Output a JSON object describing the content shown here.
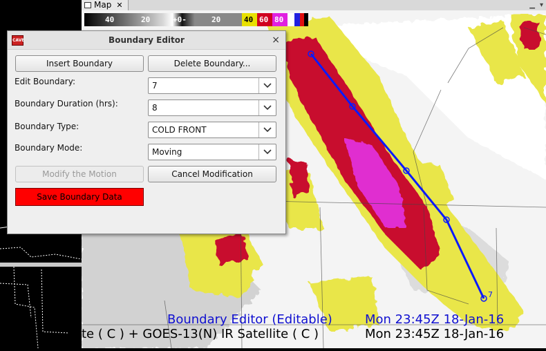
{
  "app": {
    "map_tab_label": "Map",
    "close_glyph": "✕",
    "menu_glyph": "▾"
  },
  "colorbar": {
    "ticks": [
      "40",
      "20",
      "+0-",
      "20",
      "40",
      "60",
      "80"
    ]
  },
  "overlays": {
    "boundary_editor_label": "Boundary Editor (Editable)",
    "boundary_editor_time": "Mon 23:45Z 18-Jan-16",
    "satellite_label": "te ( C )  + GOES-13(N) IR Satellite ( C )",
    "satellite_time": "Mon 23:45Z 18-Jan-16"
  },
  "boundary": {
    "end_label": "7",
    "line_color": "#0a1aff"
  },
  "dialog": {
    "title": "Boundary Editor",
    "close_glyph": "×",
    "insert_button": "Insert Boundary",
    "delete_button": "Delete Boundary...",
    "edit_boundary_label": "Edit Boundary:",
    "edit_boundary_value": "7",
    "duration_label": "Boundary Duration (hrs):",
    "duration_value": "8",
    "type_label": "Boundary Type:",
    "type_value": "COLD FRONT",
    "mode_label": "Boundary Mode:",
    "mode_value": "Moving",
    "modify_motion_button": "Modify the Motion",
    "cancel_modification_button": "Cancel Modification",
    "save_button": "Save Boundary Data"
  },
  "colors": {
    "save_button_bg": "#ff0000",
    "dialog_bg": "#efefef"
  }
}
